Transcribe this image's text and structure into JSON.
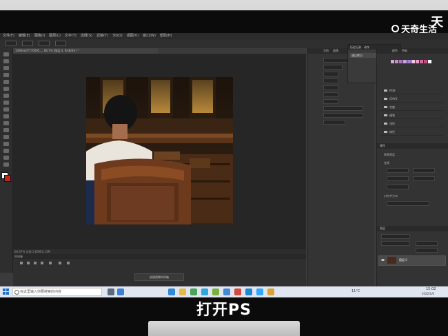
{
  "watermark": {
    "big": "天着",
    "small": "天奇生活"
  },
  "caption": "打开PS",
  "photoshop": {
    "menu": [
      "文件(F)",
      "编辑(E)",
      "图像(I)",
      "图层(L)",
      "文字(Y)",
      "选择(S)",
      "滤镜(T)",
      "3D(D)",
      "视图(V)",
      "窗口(W)",
      "帮助(H)"
    ],
    "document_tab": "1496ee07770695..., 66.7% (图层 0, RGB/8#) *",
    "status": "66.67%   文档:1.60M/2.13M",
    "timeline_header": "时间轴",
    "timeline_button": "创建视频时间轴",
    "mid_panel_tabs": [
      "字符",
      "段落"
    ],
    "history_tabs": [
      "历史记录",
      "动作"
    ],
    "history_item": "通过拷贝",
    "right_panel_tabs": [
      "颜色",
      "色板"
    ],
    "library_folders": [
      "RGB",
      "CMYK",
      "灰度",
      "蜡笔",
      "浅色",
      "纯色"
    ],
    "properties_header": "属性",
    "properties_subheader": "像素图层",
    "transform_label": "变换",
    "align_label": "对齐并分布",
    "layers_header": "图层",
    "layer_name": "图层 0",
    "swatch_colors": [
      "#d7a6d8",
      "#c78bc9",
      "#b071c0",
      "#c9a2e3",
      "#a57fd6",
      "#f0c9e3",
      "#e6a0c8",
      "#d16ba5",
      "#c84a7a",
      "#ffffff"
    ]
  },
  "taskbar": {
    "search_placeholder": "在这里输入你要搜索的内容",
    "weather": "11°C",
    "time": "15:02",
    "date": "2022/1/6"
  },
  "icons": [
    "search-icon",
    "windows-logo-icon",
    "folder-icon",
    "eye-icon"
  ]
}
